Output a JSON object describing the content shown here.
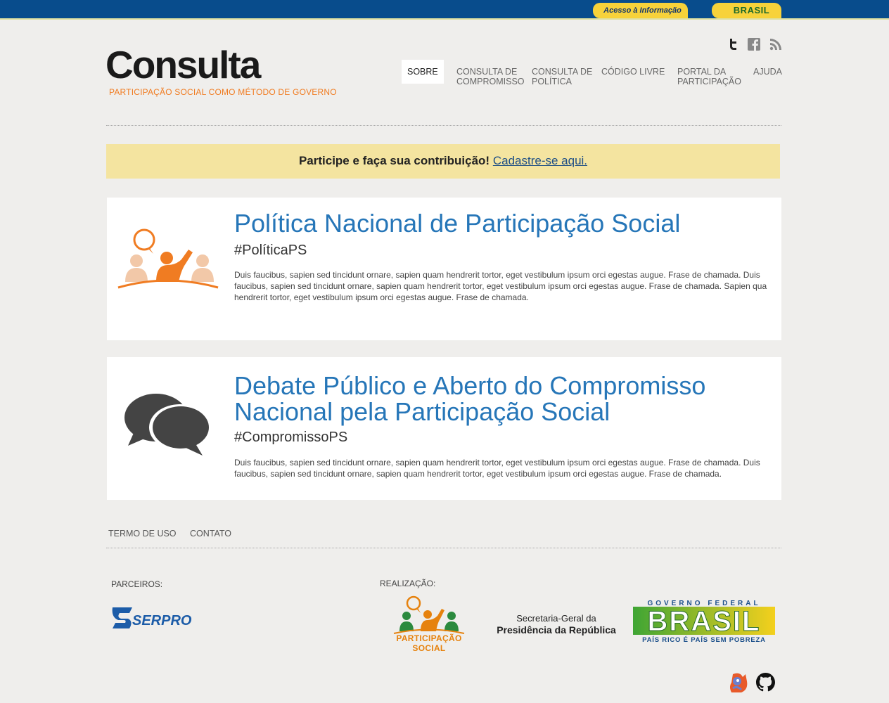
{
  "govbar": {
    "acesso_label": "Acesso à Informação",
    "brasil_label": "BRASIL"
  },
  "header": {
    "title": "Consulta",
    "subtitle": "PARTICIPAÇÃO SOCIAL COMO MÉTODO DE GOVERNO"
  },
  "social": {
    "icons": [
      "twitter-icon",
      "facebook-icon",
      "rss-icon"
    ]
  },
  "nav": {
    "items": [
      {
        "label": "SOBRE",
        "active": true
      },
      {
        "label": "CONSULTA DE COMPROMISSO"
      },
      {
        "label": "CONSULTA DE POLÍTICA"
      },
      {
        "label": "CÓDIGO LIVRE"
      },
      {
        "label": "PORTAL DA PARTICIPAÇÃO"
      },
      {
        "label": "AJUDA"
      }
    ]
  },
  "banner": {
    "text": "Participe e faça sua contribuição!",
    "link": "Cadastre-se aqui."
  },
  "cards": [
    {
      "title": "Política Nacional de Participação Social",
      "tag": "#PolíticaPS",
      "desc": "Duis faucibus, sapien sed tincidunt ornare, sapien quam hendrerit tortor, eget vestibulum ipsum orci egestas augue. Frase de chamada. Duis faucibus, sapien sed tincidunt ornare, sapien quam hendrerit tortor, eget vestibulum ipsum orci egestas augue. Frase de chamada. Sapien qua hendrerit tortor, eget vestibulum ipsum orci egestas augue. Frase de chamada."
    },
    {
      "title": "Debate Público e Aberto do Compromisso Nacional pela Participação Social",
      "tag": "#CompromissoPS",
      "desc": "Duis faucibus, sapien sed tincidunt ornare, sapien quam hendrerit tortor, eget vestibulum ipsum orci egestas augue. Frase de chamada. Duis faucibus, sapien sed tincidunt ornare, sapien quam hendrerit tortor, eget vestibulum ipsum orci egestas augue. Frase de chamada."
    }
  ],
  "footer": {
    "links": [
      "TERMO DE USO",
      "CONTATO"
    ],
    "partners_label": "PARCEIROS:",
    "realizacao_label": "REALIZAÇÃO:",
    "serpro_label": "SERPRO",
    "ps_label": "PARTICIPAÇÃO SOCIAL",
    "sg_line1": "Secretaria-Geral da",
    "sg_line2": "Presidência da República",
    "brasil_top": "GOVERNO FEDERAL",
    "brasil_mid": "BRASIL",
    "brasil_bot": "PAÍS RICO É PAÍS SEM POBREZA",
    "bottom_icons": [
      "mascot-icon",
      "github-icon"
    ]
  },
  "colors": {
    "govbar": "#084c8c",
    "accent_orange": "#f07c22",
    "link_blue": "#2676b8",
    "banner_bg": "#f4e4a0"
  }
}
